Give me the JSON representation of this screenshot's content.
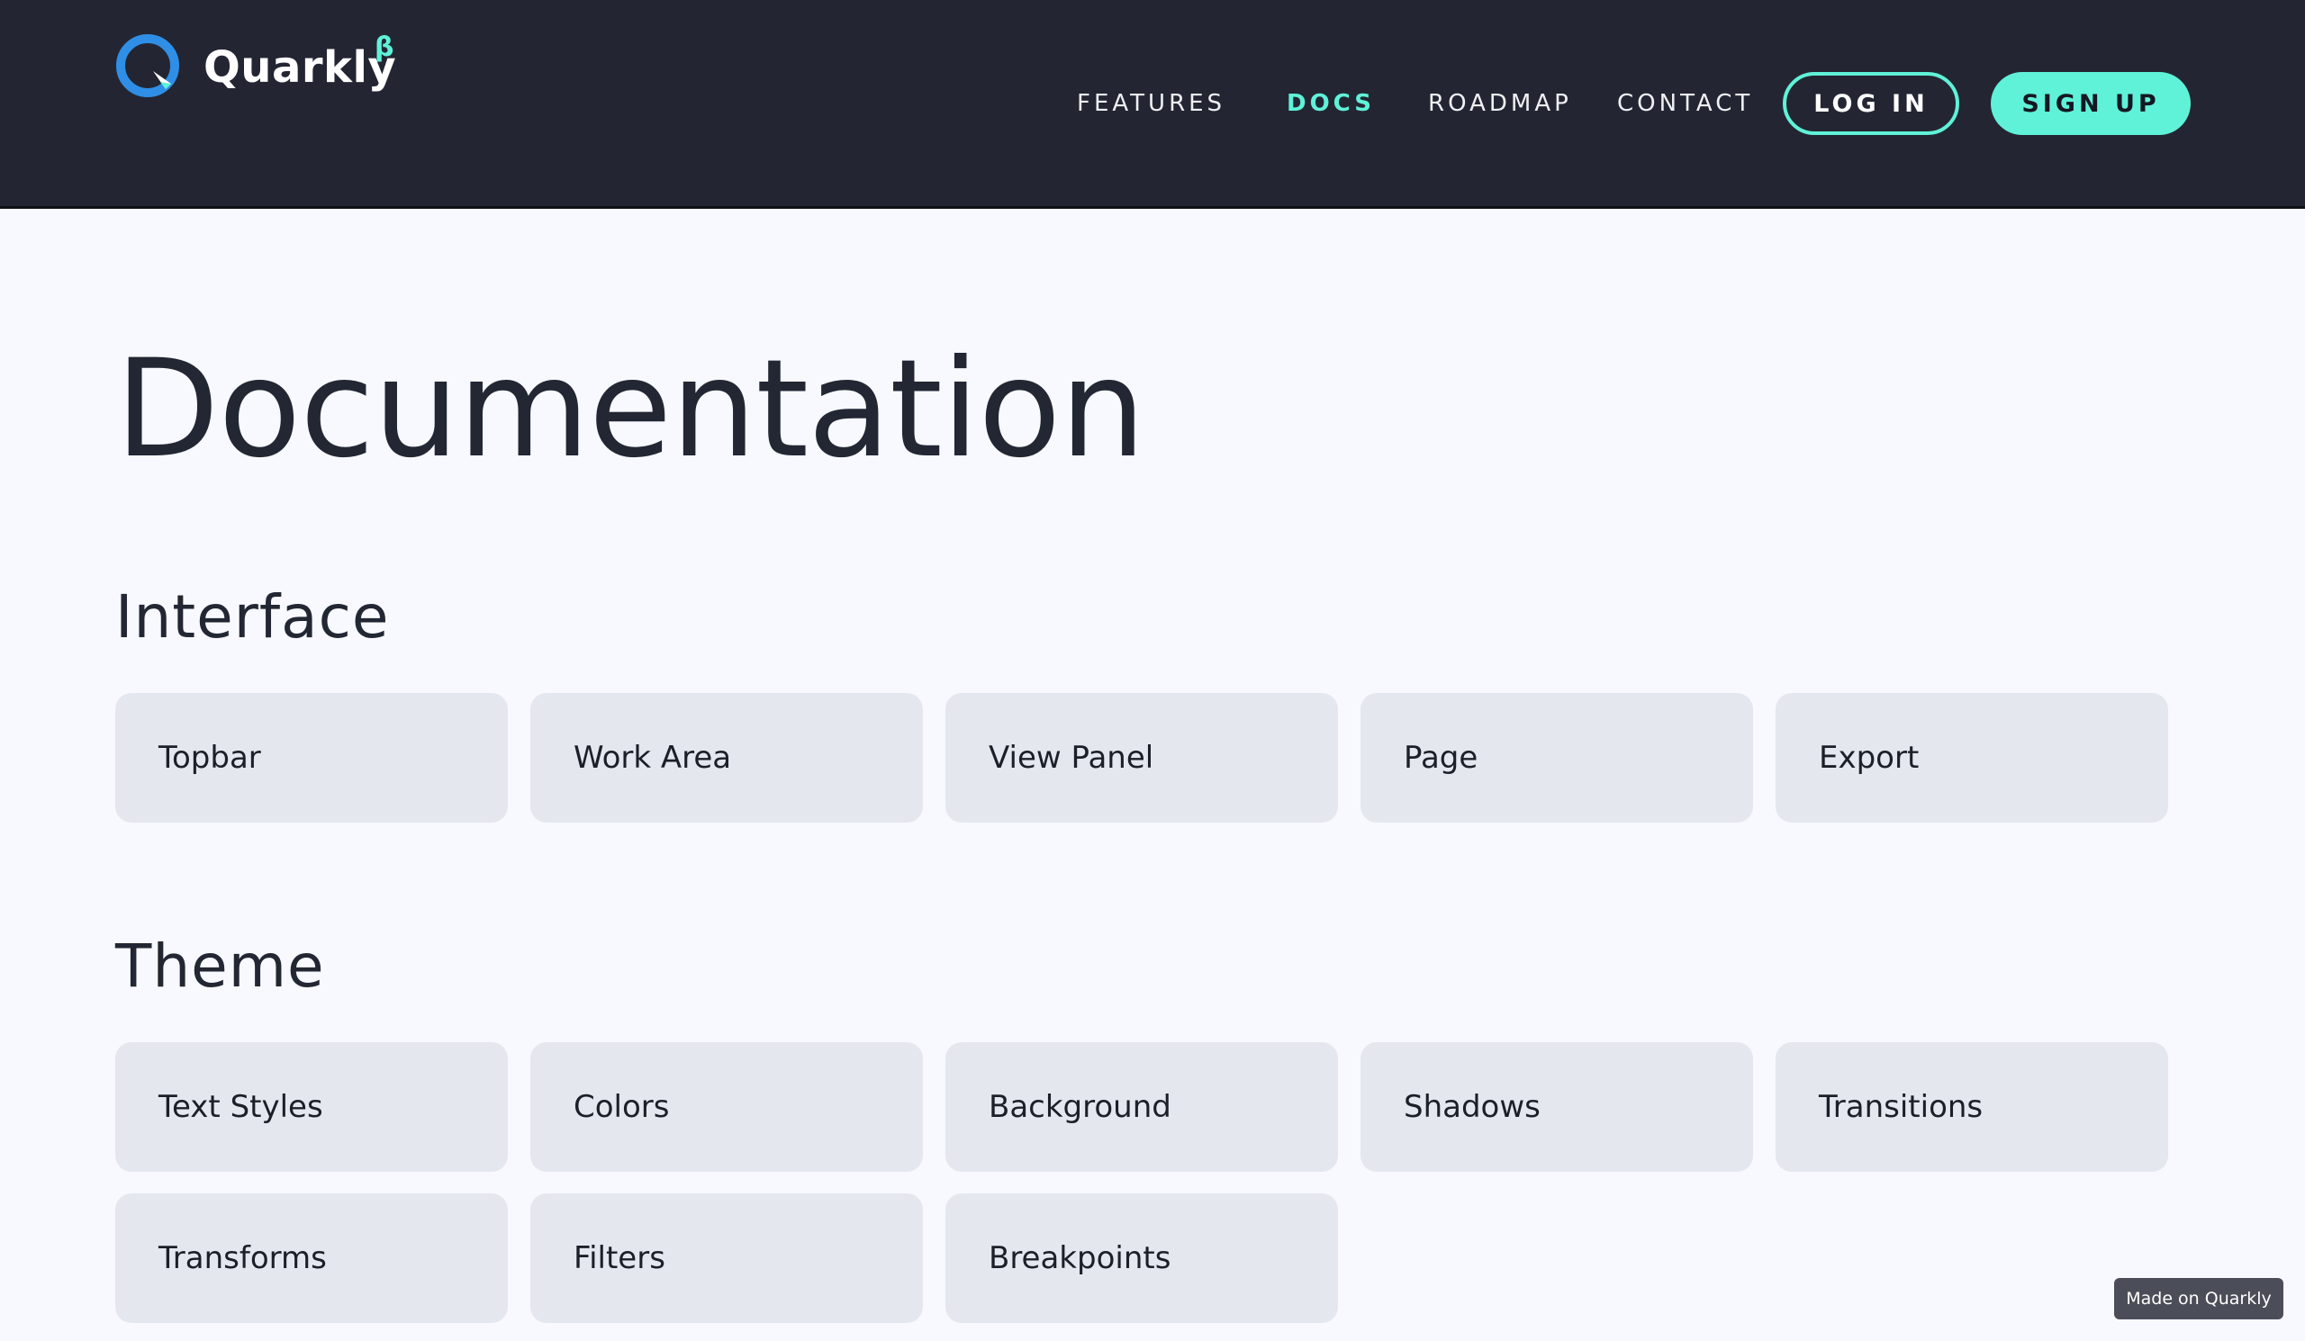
{
  "brand": {
    "name": "Quarkly",
    "beta": "β",
    "icon": "quarkly-q-logo-icon"
  },
  "nav": {
    "features": "FEATURES",
    "docs": "DOCS",
    "roadmap": "ROADMAP",
    "contact": "CONTACT",
    "login": "LOG IN",
    "signup": "SIGN UP"
  },
  "colors": {
    "header_bg": "#232632",
    "accent": "#5ff2d8",
    "page_bg": "#f7f9fe",
    "card_bg": "#e4e7ed"
  },
  "page": {
    "title": "Documentation"
  },
  "sections": [
    {
      "title": "Interface",
      "items": [
        "Topbar",
        "Work Area",
        "View Panel",
        "Page",
        "Export"
      ]
    },
    {
      "title": "Theme",
      "items": [
        "Text Styles",
        "Colors",
        "Background",
        "Shadows",
        "Transitions",
        "Transforms",
        "Filters",
        "Breakpoints"
      ]
    }
  ],
  "badge": "Made on Quarkly"
}
